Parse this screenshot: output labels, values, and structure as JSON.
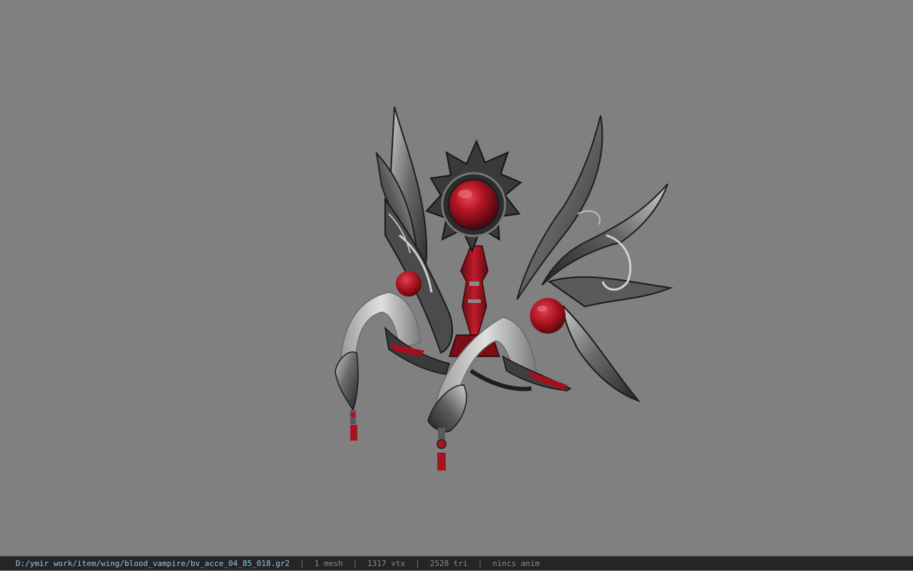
{
  "viewport": {
    "background_color": "#808080",
    "model_name": "wing-ornament-model",
    "colors": {
      "metal_dark": "#2e2e2e",
      "metal_mid": "#6b6b6b",
      "metal_light": "#b9b9b9",
      "ribbon": "#d4d4d4",
      "blood_red": "#b01422",
      "blood_dark": "#5e0a10"
    }
  },
  "status_bar": {
    "file_path": "D:/ymir work/item/wing/blood_vampire/bv_acce_04_85_018.gr2",
    "separator": "|",
    "mesh_count": "1 mesh",
    "vertex_count": "1317 vtx",
    "triangle_count": "2528 tri",
    "anim_status": "nincs anim"
  }
}
